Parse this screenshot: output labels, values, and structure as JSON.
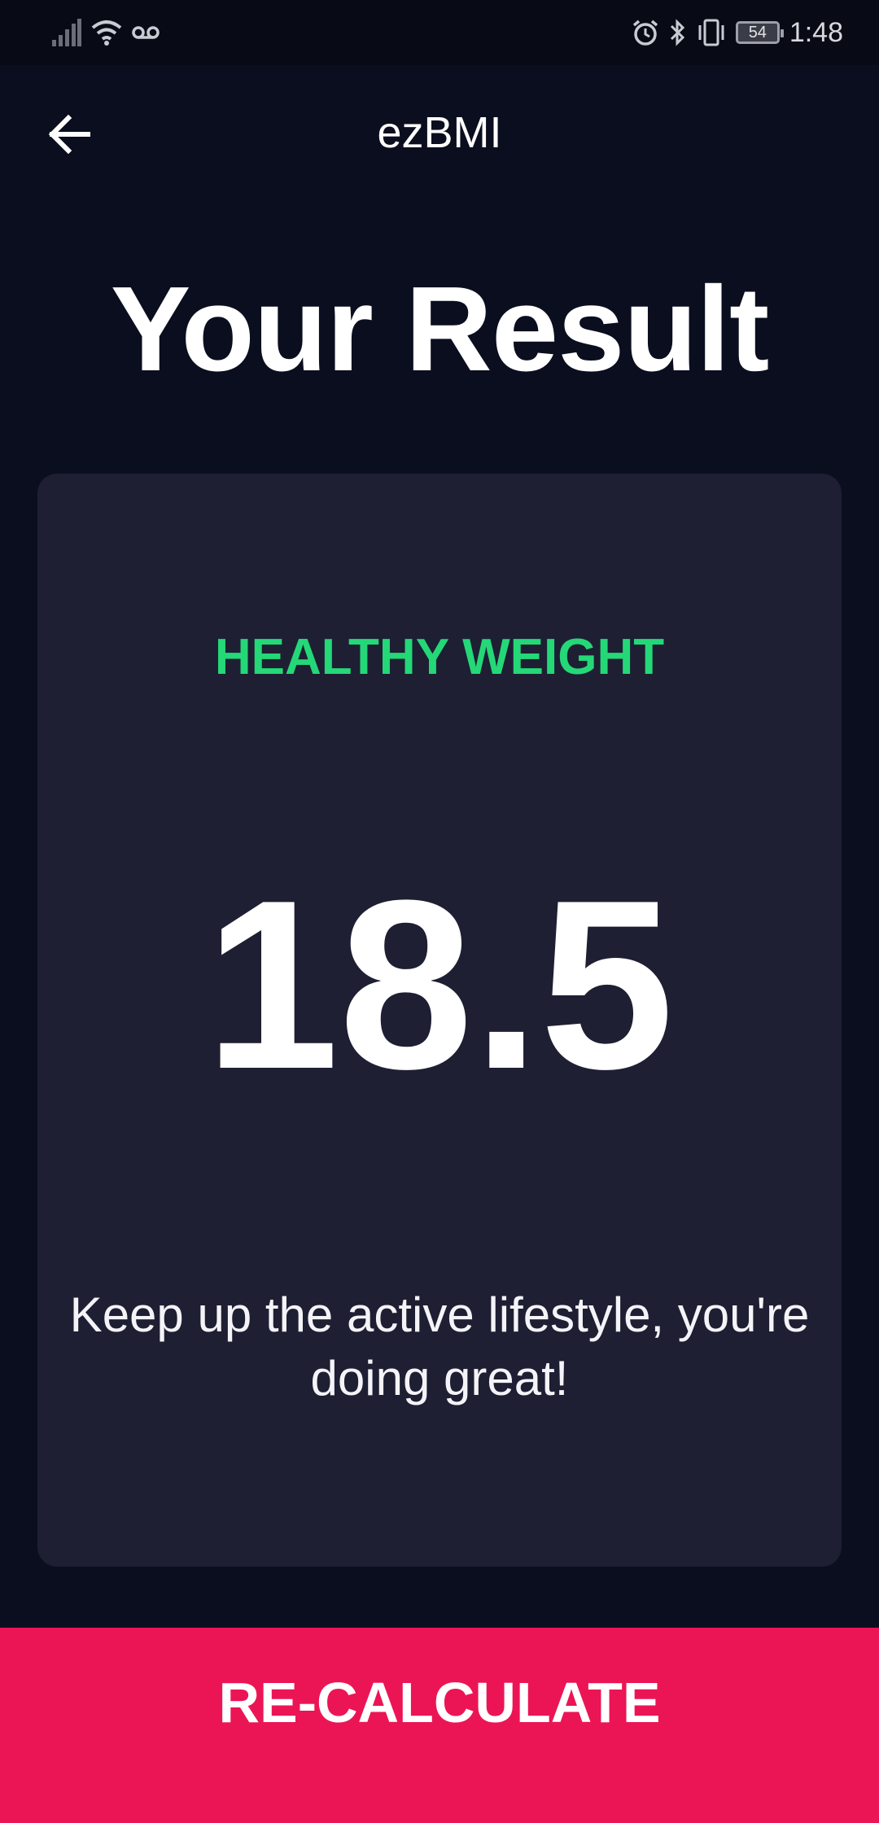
{
  "status_bar": {
    "battery_level": "54",
    "time": "1:48",
    "icons": [
      "signal-icon",
      "wifi-icon",
      "voicemail-icon",
      "alarm-icon",
      "bluetooth-icon",
      "vibrate-icon",
      "battery-icon"
    ]
  },
  "app_bar": {
    "title": "ezBMI",
    "back_icon": "arrow-left-icon"
  },
  "page": {
    "title": "Your Result"
  },
  "result": {
    "category": "HEALTHY WEIGHT",
    "bmi": "18.5",
    "message": "Keep up the active lifestyle, you're doing great!"
  },
  "actions": {
    "recalculate_label": "RE-CALCULATE"
  },
  "colors": {
    "background": "#0b0e1e",
    "card": "#1e1f33",
    "category_green": "#24d877",
    "accent_pink": "#eb1555"
  }
}
